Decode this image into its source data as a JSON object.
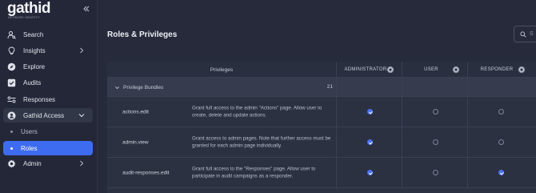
{
  "app": {
    "logo_text": "gathid",
    "logo_subtitle": "NETWORK IDENTITY"
  },
  "sidebar": {
    "items": [
      {
        "label": "Search",
        "icon": "search-person-icon"
      },
      {
        "label": "Insights",
        "icon": "lightbulb-icon",
        "has_chevron": true
      },
      {
        "label": "Explore",
        "icon": "compass-icon"
      },
      {
        "label": "Audits",
        "icon": "checkbox-icon"
      },
      {
        "label": "Responses",
        "icon": "list-toggle-icon"
      },
      {
        "label": "Gathid Access",
        "icon": "shield-person-icon",
        "expanded": true
      },
      {
        "label": "Users",
        "sub": true
      },
      {
        "label": "Roles",
        "sub": true,
        "active": true
      },
      {
        "label": "Admin",
        "icon": "gear-icon",
        "has_chevron": true
      }
    ]
  },
  "main": {
    "title": "Roles & Privileges",
    "search_placeholder": "S"
  },
  "table": {
    "privileges_header": "Privileges",
    "roles": [
      "ADMINISTRATOR",
      "USER",
      "RESPONDER"
    ],
    "bundle": {
      "label": "Privilege Bundles",
      "count": "21"
    },
    "rows": [
      {
        "key": "actions.edit",
        "desc": "Grant full access to the admin \"Actions\" page. Allow user to create, delete and update actions.",
        "checks": [
          true,
          false,
          false
        ]
      },
      {
        "key": "admin.view",
        "desc": "Grant access to admin pages. Note that further access must be granted for each admin page individually.",
        "checks": [
          true,
          false,
          false
        ]
      },
      {
        "key": "audit-responses.edit",
        "desc": "Grant full access to the \"Responses\" page. Allow user to participate in audit campaigns as a responder.",
        "checks": [
          true,
          false,
          true
        ]
      }
    ]
  },
  "colors": {
    "accent": "#3e6cf0",
    "background": "#262a3b",
    "sidebar": "#232738",
    "checked": "#4b72ee"
  }
}
